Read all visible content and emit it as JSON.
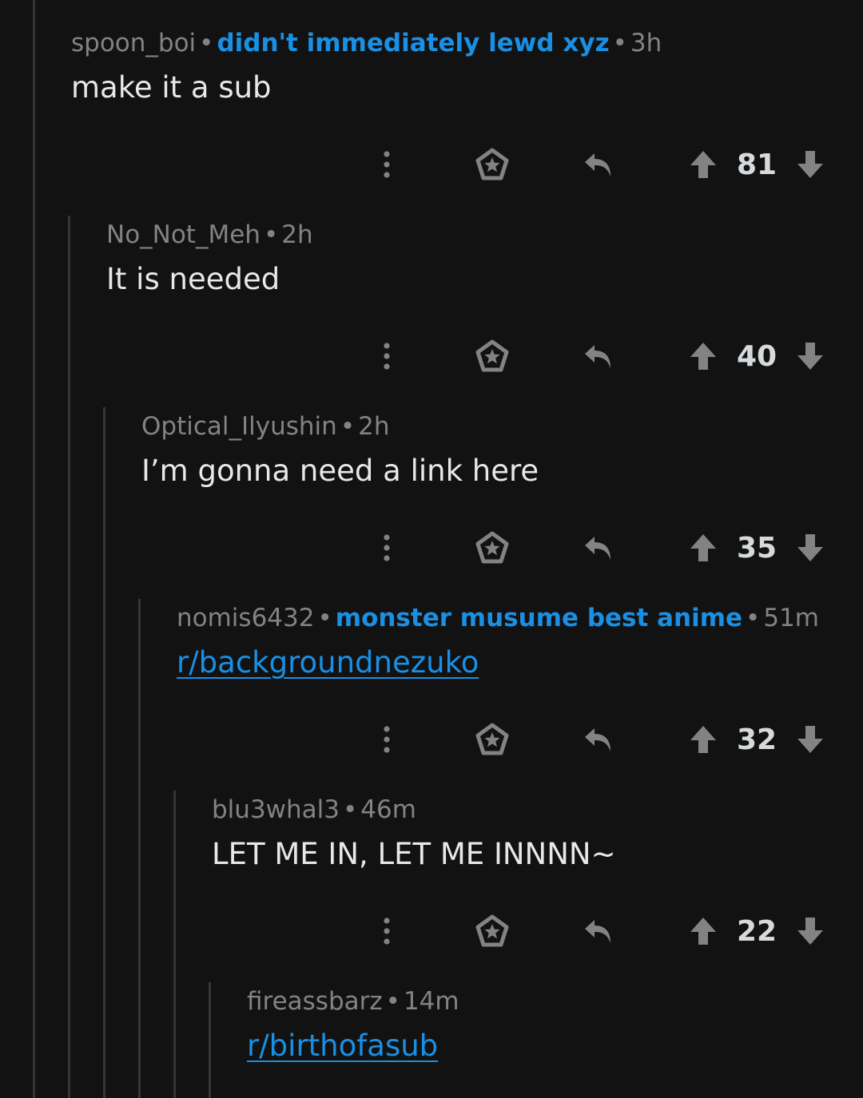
{
  "comments": [
    {
      "username": "spoon_boi",
      "flair": "didn't immediately lewd xyz",
      "time": "3h",
      "body": "make it a sub",
      "is_link": false,
      "score": "81"
    },
    {
      "username": "No_Not_Meh",
      "flair": "",
      "time": "2h",
      "body": "It is needed",
      "is_link": false,
      "score": "40"
    },
    {
      "username": "Optical_Ilyushin",
      "flair": "",
      "time": "2h",
      "body": "I’m gonna need a link here",
      "is_link": false,
      "score": "35"
    },
    {
      "username": "nomis6432",
      "flair": "monster musume best anime",
      "time": "51m",
      "body": "r/backgroundnezuko",
      "is_link": true,
      "score": "32"
    },
    {
      "username": "blu3whal3",
      "flair": "",
      "time": "46m",
      "body": "LET ME IN, LET ME INNNN~",
      "is_link": false,
      "score": "22"
    },
    {
      "username": "fireassbarz",
      "flair": "",
      "time": "14m",
      "body": "r/birthofasub",
      "is_link": true,
      "score": ""
    }
  ],
  "icons": {
    "more": "more-options-icon",
    "award": "award-icon",
    "reply": "reply-icon",
    "upvote": "upvote-arrow-icon",
    "downvote": "downvote-arrow-icon"
  },
  "colors": {
    "background": "#121212",
    "thread_line": "#343536",
    "meta_text": "#818384",
    "flair_link": "#1a8fe3",
    "body_text": "#e6e8ea",
    "icon": "#818384"
  }
}
